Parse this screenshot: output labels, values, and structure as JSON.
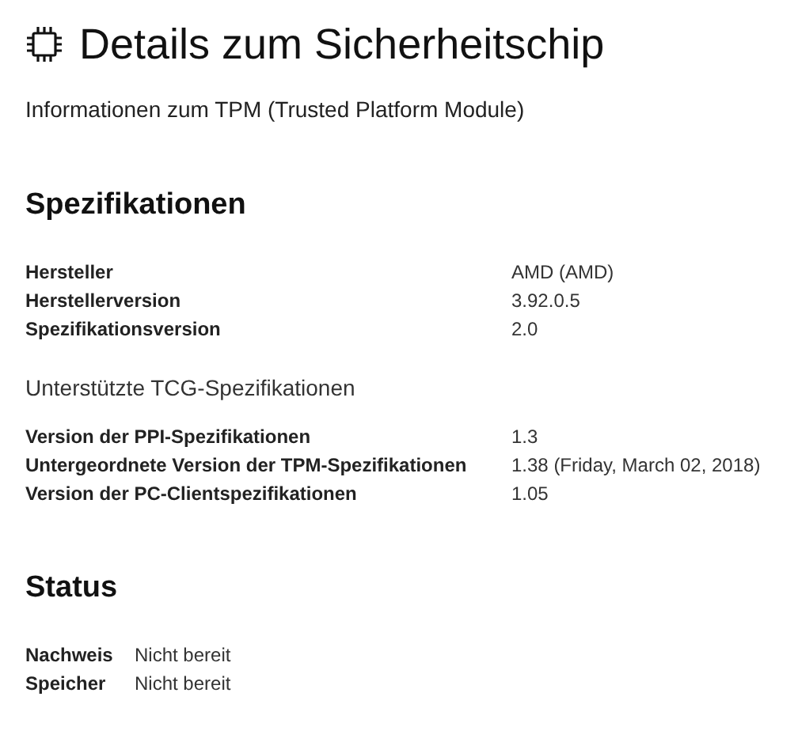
{
  "title": "Details zum Sicherheitschip",
  "subtitle": "Informationen zum TPM (Trusted Platform Module)",
  "sections": [
    {
      "heading": "Spezifikationen",
      "kind": "wide",
      "groups": [
        {
          "rows": [
            {
              "label": "Hersteller",
              "value": "AMD (AMD)"
            },
            {
              "label": "Herstellerversion",
              "value": "3.92.0.5"
            },
            {
              "label": "Spezifikationsversion",
              "value": "2.0"
            }
          ]
        },
        {
          "subheading": "Unterstützte TCG-Spezifikationen",
          "rows": [
            {
              "label": "Version der PPI-Spezifikationen",
              "value": "1.3"
            },
            {
              "label": "Untergeordnete Version der TPM-Spezifikationen",
              "value": "1.38 (Friday, March 02, 2018)"
            },
            {
              "label": "Version der PC-Clientspezifikationen",
              "value": "1.05"
            }
          ]
        }
      ]
    },
    {
      "heading": "Status",
      "kind": "narrow",
      "groups": [
        {
          "rows": [
            {
              "label": "Nachweis",
              "value": "Nicht bereit"
            },
            {
              "label": "Speicher",
              "value": "Nicht bereit"
            }
          ]
        }
      ]
    }
  ]
}
